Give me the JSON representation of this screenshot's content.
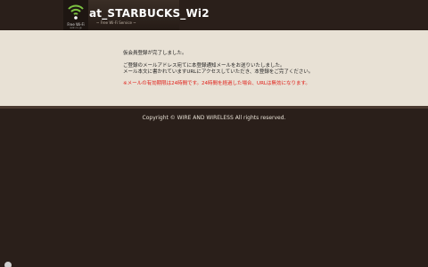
{
  "header": {
    "logo_line1": "Free Wi-Fi",
    "logo_line2": "wi2.co.jp",
    "title": "at_STARBUCKS_Wi2",
    "tagline": "~ Free Wi-Fi Service ~"
  },
  "content": {
    "line1": "仮会員登録が完了しました。",
    "line2": "ご登録のメールアドレス宛てに本登録通知メールをお送りいたしました。",
    "line3": "メール本文に書かれていますURLにアクセスしていただき、本登録をご完了ください。",
    "warning": "※メールの有効期限は24時間です。24時間を経過した場合、URLは無効になります。"
  },
  "footer": {
    "copyright": "Copyright © WIRE AND WIRELESS All rights reserved."
  },
  "colors": {
    "background": "#2a1f1a",
    "content_bg": "#e8e1d5",
    "warning": "#e0201a",
    "wifi_green": "#7cc242"
  }
}
